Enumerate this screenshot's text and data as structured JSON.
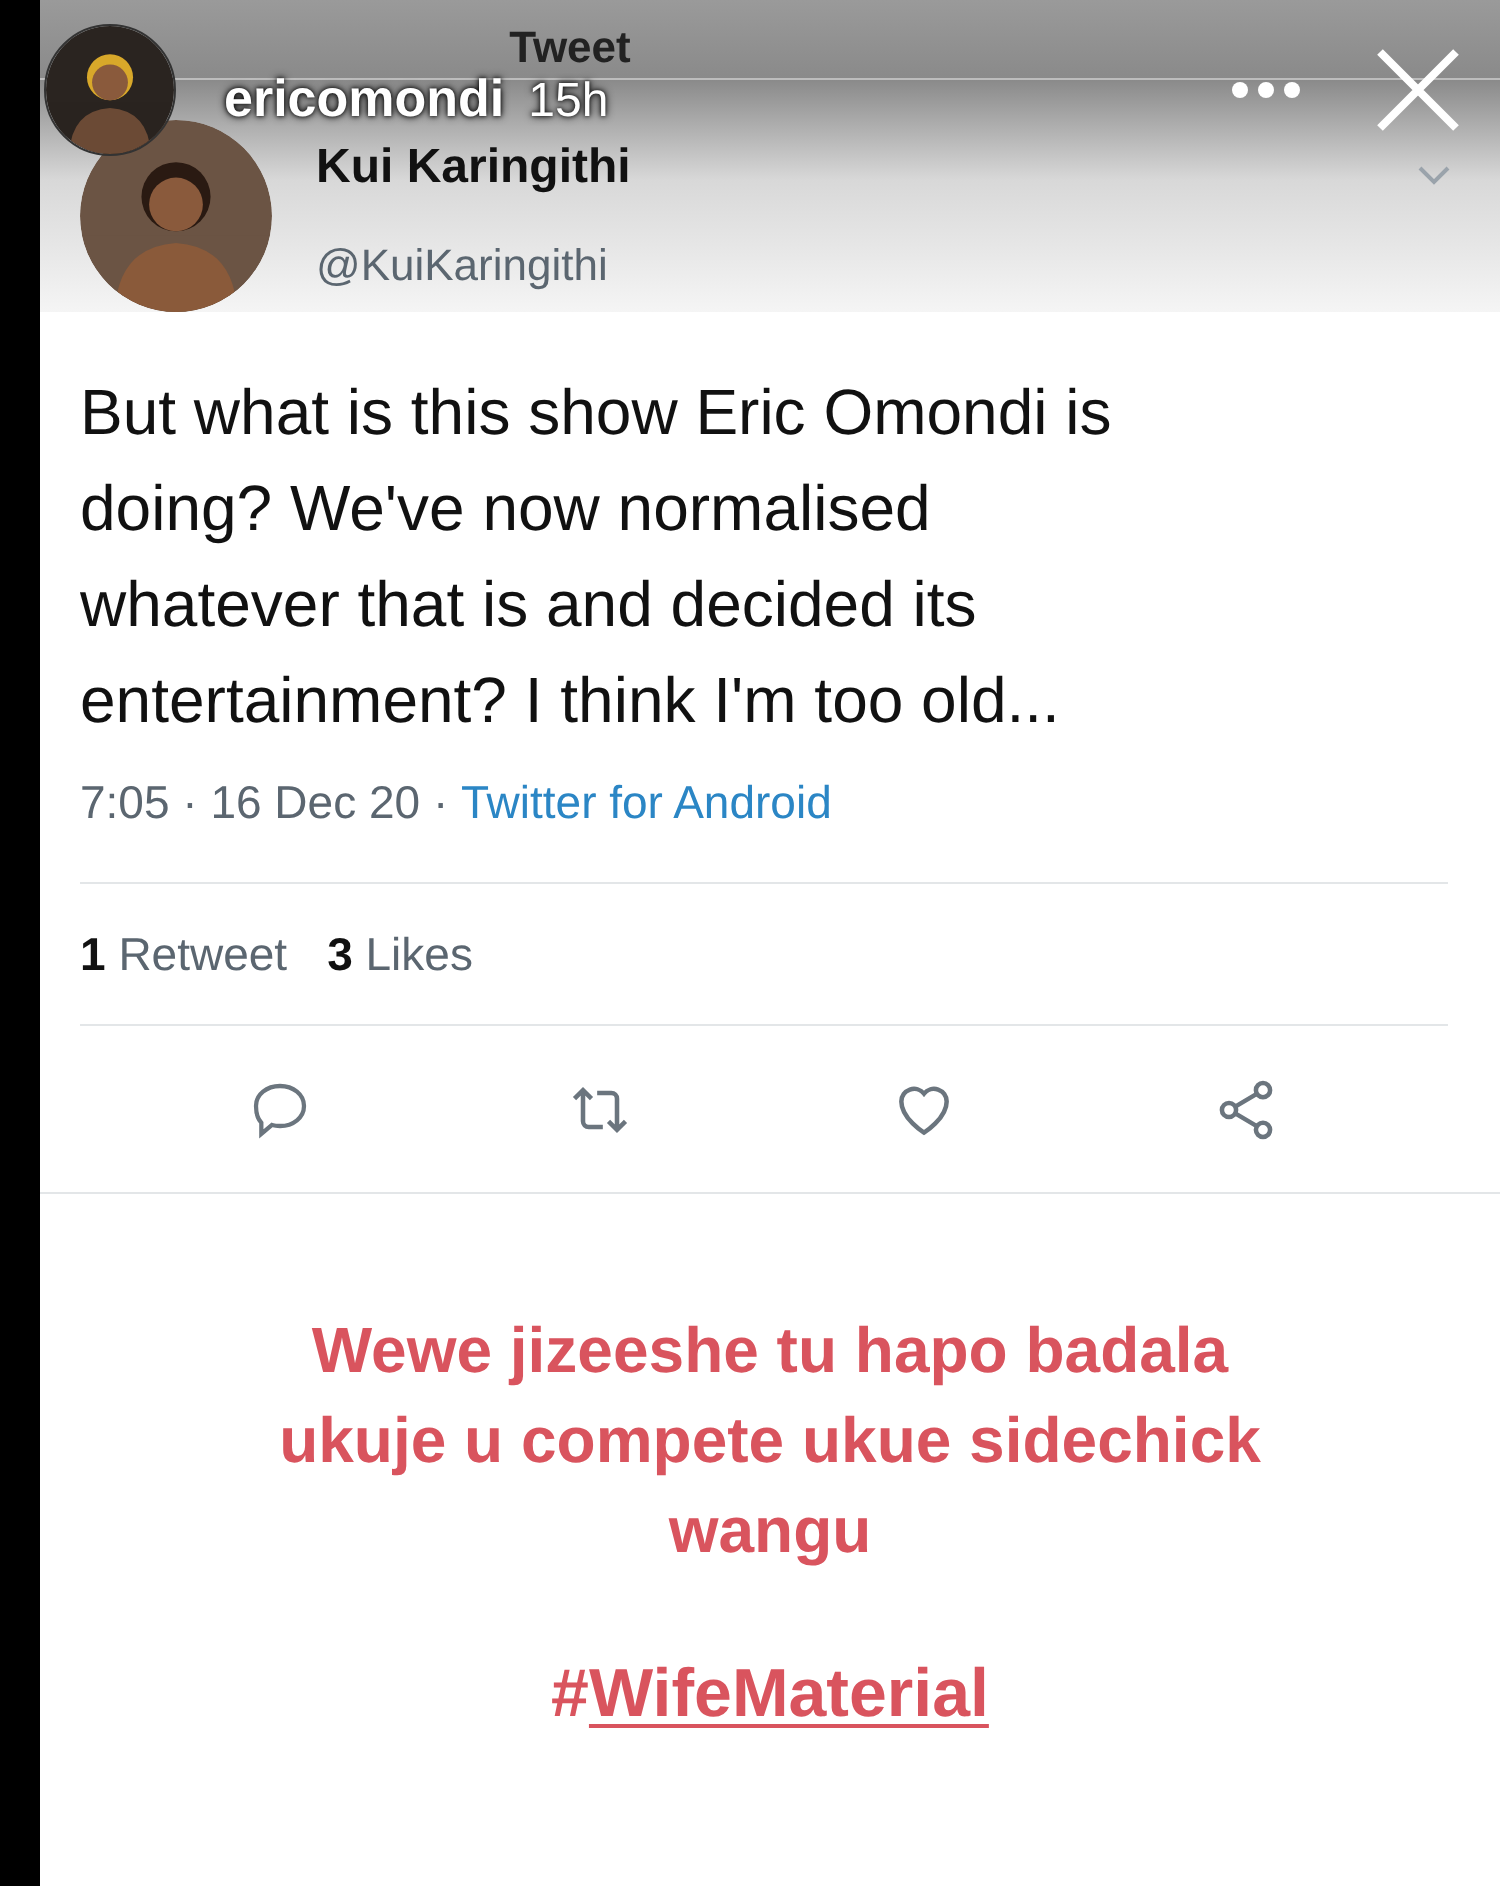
{
  "screen_title": "Tweet",
  "story": {
    "username": "ericomondi",
    "age": "15h"
  },
  "tweet": {
    "name": "Kui Karingithi",
    "handle": "@KuiKaringithi",
    "text": "But what is this show Eric Omondi is doing? We've now normalised whatever that is and decided its entertainment? I think I'm too old...",
    "time": "7:05",
    "separator": "·",
    "date": "16 Dec 20",
    "source": "Twitter for Android",
    "stats": [
      {
        "count": "1",
        "label": "Retweet"
      },
      {
        "count": "3",
        "label": "Likes"
      }
    ]
  },
  "caption": {
    "text": "Wewe jizeeshe tu hapo badala ukuje u compete ukue sidechick wangu",
    "hashtag_symbol": "#",
    "hashtag": "WifeMaterial"
  }
}
